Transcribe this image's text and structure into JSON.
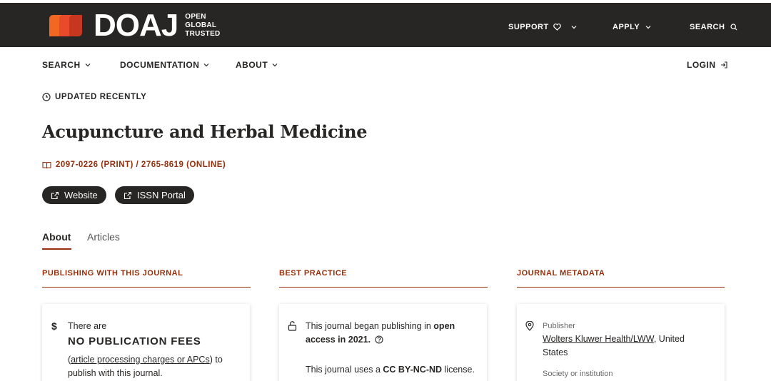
{
  "header": {
    "logo_word": "DOAJ",
    "logo_tag": [
      "OPEN",
      "GLOBAL",
      "TRUSTED"
    ],
    "nav": [
      {
        "label": "SUPPORT"
      },
      {
        "label": "APPLY"
      },
      {
        "label": "SEARCH"
      }
    ]
  },
  "subnav": {
    "items": [
      {
        "label": "SEARCH"
      },
      {
        "label": "DOCUMENTATION"
      },
      {
        "label": "ABOUT"
      }
    ],
    "login": "LOGIN"
  },
  "journal": {
    "updated": "UPDATED RECENTLY",
    "title": "Acupuncture and Herbal Medicine",
    "issn": "2097-0226 (PRINT) / 2765-8619 (ONLINE)",
    "buttons": [
      {
        "label": "Website"
      },
      {
        "label": "ISSN Portal"
      }
    ]
  },
  "tabs": [
    {
      "label": "About",
      "active": true
    },
    {
      "label": "Articles",
      "active": false
    }
  ],
  "columns": [
    {
      "heading": "PUBLISHING WITH THIS JOURNAL"
    },
    {
      "heading": "BEST PRACTICE"
    },
    {
      "heading": "JOURNAL METADATA"
    }
  ],
  "cards": {
    "fees": {
      "icon": "dollar-icon",
      "intro": "There are",
      "headline": "NO PUBLICATION FEES",
      "link": "article processing charges or APCs",
      "tail": "to",
      "line3": "publish with this journal."
    },
    "practice": {
      "icon": "unlock-icon",
      "line1_a": "This journal began publishing in",
      "line1_b": "open",
      "line2_a": "access in 2021.",
      "line3_a": "This journal uses a",
      "line3_b": "CC BY-NC-ND",
      "line3_c": "license."
    },
    "metadata": {
      "icon": "location-pin-icon",
      "label": "Publisher",
      "publisher_link": "Wolters Kluwer Health/LWW",
      "publisher_tail": ", United",
      "country_line2": "States",
      "society_label": "Society or institution"
    }
  },
  "colors": {
    "brand_dark": "#282624",
    "accent_red": "#982e0a",
    "logo_orange": "#f26722"
  }
}
